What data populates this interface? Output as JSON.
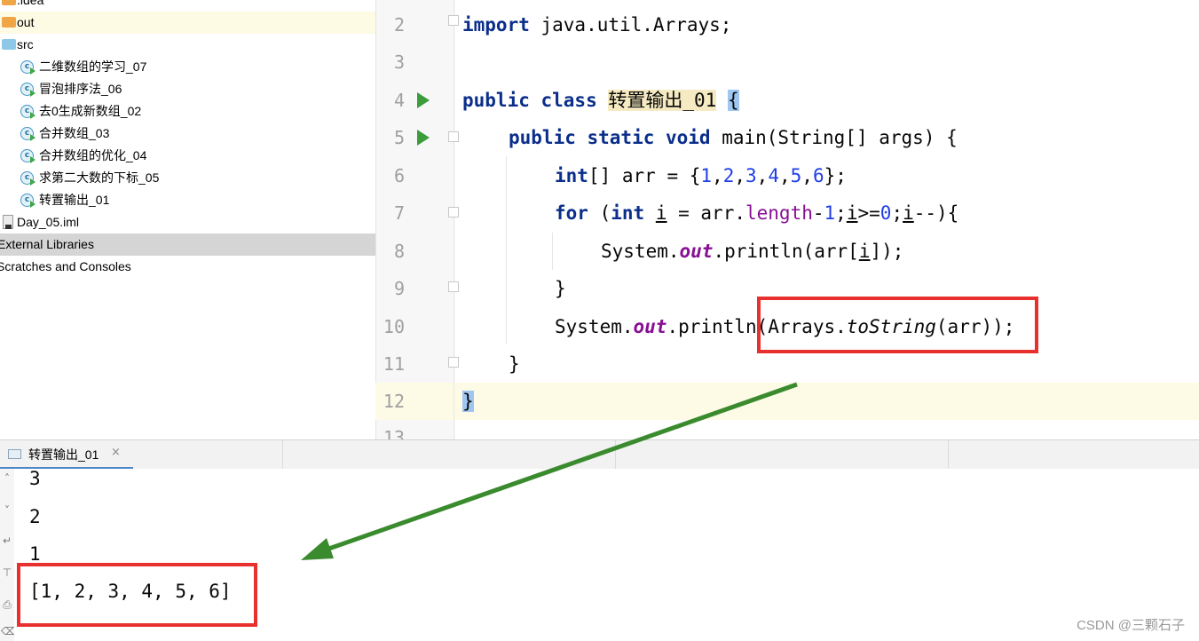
{
  "project_tree": {
    "items": [
      {
        "label": ".idea"
      },
      {
        "label": "out"
      },
      {
        "label": "src"
      },
      {
        "label": "二维数组的学习_07"
      },
      {
        "label": "冒泡排序法_06"
      },
      {
        "label": "去0生成新数组_02"
      },
      {
        "label": "合并数组_03"
      },
      {
        "label": "合并数组的优化_04"
      },
      {
        "label": "求第二大数的下标_05"
      },
      {
        "label": "转置输出_01"
      },
      {
        "label": "Day_05.iml"
      },
      {
        "label": "External Libraries"
      },
      {
        "label": "Scratches and Consoles"
      }
    ]
  },
  "editor": {
    "line_numbers": [
      "2",
      "3",
      "4",
      "5",
      "6",
      "7",
      "8",
      "9",
      "10",
      "11",
      "12",
      "13"
    ],
    "code": {
      "l2_kw": "import",
      "l2_rest": " java.util.Arrays;",
      "l4_kw": "public class",
      "l4_class": "转置输出_01",
      "l4_brace": "{",
      "l5_kw": "public static void",
      "l5_rest": " main(String[] args) {",
      "l6_kw": "int",
      "l6_rest": "[] arr = {",
      "l6_n1": "1",
      "l6_n2": "2",
      "l6_n3": "3",
      "l6_n4": "4",
      "l6_n5": "5",
      "l6_n6": "6",
      "l6_end": "};",
      "l7_for": "for",
      "l7_a": " (",
      "l7_int": "int",
      "l7_b": " ",
      "l7_i1": "i",
      "l7_c": " = arr.",
      "l7_length": "length",
      "l7_d": "-",
      "l7_n1": "1",
      "l7_e": ";",
      "l7_i2": "i",
      "l7_f": ">=",
      "l7_n0": "0",
      "l7_g": ";",
      "l7_i3": "i",
      "l7_h": "--){",
      "l8_a": "System.",
      "l8_out": "out",
      "l8_b": ".println(arr[",
      "l8_i": "i",
      "l8_c": "]);",
      "l9": "}",
      "l10_a": "System.",
      "l10_out": "out",
      "l10_b": ".println(Arrays.",
      "l10_tostring": "toString",
      "l10_c": "(arr));",
      "l11": "}",
      "l12": "}"
    }
  },
  "run_panel": {
    "tab_label": "转置输出_01",
    "tab_close": "×",
    "output": [
      "3",
      "2",
      "1",
      "[1, 2, 3, 4, 5, 6]"
    ]
  },
  "watermark": "CSDN @三颗石子",
  "colors": {
    "keyword": "#0a2e8a",
    "number": "#1f3ee6",
    "field": "#871094",
    "highlight_box": "#e8312e",
    "arrow": "#3a8a2e",
    "run_icon": "#3a9c3a"
  },
  "icons": {
    "run_gutter": "run-icon",
    "class_file": "java-class-icon",
    "folder": "folder-icon"
  }
}
